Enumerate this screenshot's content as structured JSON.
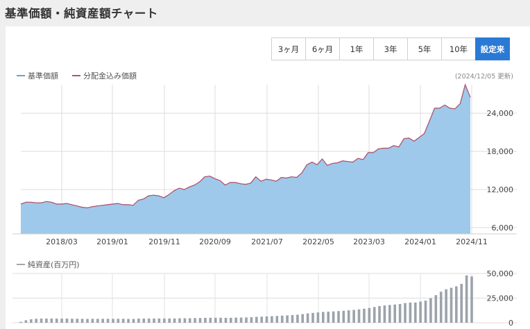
{
  "page": {
    "title": "基準価額・純資産額チャート"
  },
  "period_buttons": [
    "3ヶ月",
    "6ヶ月",
    "1年",
    "3年",
    "5年",
    "10年"
  ],
  "setting_button": "設定来",
  "update_note": "(2024/12/05 更新)",
  "colors": {
    "nav_line": "#6aa0d0",
    "dist_line": "#b8516a",
    "area": "#9ec9ea",
    "bar": "#9ba3ab",
    "button_active": "#2a7ad5"
  },
  "chart_data": [
    {
      "type": "area",
      "legend": [
        "基準価額",
        "分配金込み価額"
      ],
      "legend_position": "top-left",
      "x_tick_labels": [
        "2018/03",
        "2019/01",
        "2019/11",
        "2020/09",
        "2021/07",
        "2022/05",
        "2023/03",
        "2024/01",
        "2024/11"
      ],
      "y_ticks": [
        6000,
        12000,
        18000,
        24000
      ],
      "y_tick_labels": [
        "6,000",
        "12,000",
        "18,000",
        "24,000"
      ],
      "ylim": [
        5000,
        28500
      ],
      "grid": true,
      "series": [
        {
          "name": "基準価額",
          "values": [
            9700,
            10000,
            10000,
            9900,
            9900,
            10100,
            10000,
            9700,
            9700,
            9800,
            9600,
            9400,
            9200,
            9100,
            9300,
            9400,
            9500,
            9600,
            9700,
            9800,
            9600,
            9600,
            9500,
            10300,
            10500,
            11000,
            11100,
            11000,
            10700,
            11200,
            11800,
            12200,
            12000,
            12400,
            12700,
            13200,
            14000,
            14100,
            13700,
            13400,
            12700,
            13100,
            13100,
            12900,
            12800,
            13000,
            14000,
            13300,
            13600,
            13500,
            13300,
            13900,
            13800,
            14000,
            13900,
            14600,
            15900,
            16300,
            15900,
            16800,
            15800,
            16100,
            16200,
            16500,
            16400,
            16300,
            16900,
            16700,
            17800,
            17800,
            18400,
            18500,
            18500,
            18900,
            18700,
            20000,
            20100,
            19600,
            20200,
            20800,
            22800,
            24800,
            24800,
            25300,
            24800,
            24700,
            25500,
            28500,
            26500
          ]
        },
        {
          "name": "分配金込み価額",
          "values": [
            9700,
            10000,
            10000,
            9900,
            9900,
            10100,
            10000,
            9700,
            9700,
            9800,
            9600,
            9400,
            9200,
            9100,
            9300,
            9400,
            9500,
            9600,
            9700,
            9800,
            9600,
            9600,
            9500,
            10300,
            10500,
            11000,
            11100,
            11000,
            10700,
            11200,
            11800,
            12200,
            12000,
            12400,
            12700,
            13200,
            14000,
            14100,
            13700,
            13400,
            12700,
            13100,
            13100,
            12900,
            12800,
            13000,
            14000,
            13300,
            13600,
            13500,
            13300,
            13900,
            13800,
            14000,
            13900,
            14600,
            15900,
            16300,
            15900,
            16800,
            15800,
            16100,
            16200,
            16500,
            16400,
            16300,
            16900,
            16700,
            17800,
            17800,
            18400,
            18500,
            18500,
            18900,
            18700,
            20000,
            20100,
            19600,
            20200,
            20800,
            22800,
            24800,
            24800,
            25300,
            24800,
            24700,
            25500,
            28500,
            26500
          ]
        }
      ]
    },
    {
      "type": "bar",
      "legend": [
        "純資産(百万円)"
      ],
      "legend_position": "top-left",
      "y_ticks": [
        0,
        25000,
        50000
      ],
      "y_tick_labels": [
        "0",
        "25,000",
        "50,000"
      ],
      "ylim": [
        0,
        50000
      ],
      "grid": true,
      "values": [
        1000,
        2500,
        3500,
        4000,
        4200,
        4300,
        4300,
        4200,
        4200,
        4200,
        4100,
        4100,
        4000,
        3900,
        4000,
        4000,
        4000,
        4000,
        4000,
        4000,
        4000,
        3900,
        3900,
        4200,
        4200,
        4300,
        4300,
        4300,
        4300,
        4400,
        4400,
        4500,
        4500,
        4600,
        4700,
        4800,
        5000,
        5100,
        5100,
        5100,
        5000,
        5100,
        5200,
        5300,
        5400,
        5600,
        6000,
        6200,
        6500,
        6700,
        6900,
        7200,
        7500,
        7800,
        8200,
        8800,
        9500,
        10000,
        10500,
        11000,
        11200,
        11500,
        11800,
        12200,
        12600,
        13000,
        13600,
        14200,
        15000,
        16000,
        17000,
        17500,
        18000,
        18500,
        19000,
        20000,
        20500,
        20500,
        21500,
        22500,
        25000,
        28000,
        31500,
        34000,
        35500,
        37000,
        39500,
        48000,
        47000
      ]
    }
  ]
}
